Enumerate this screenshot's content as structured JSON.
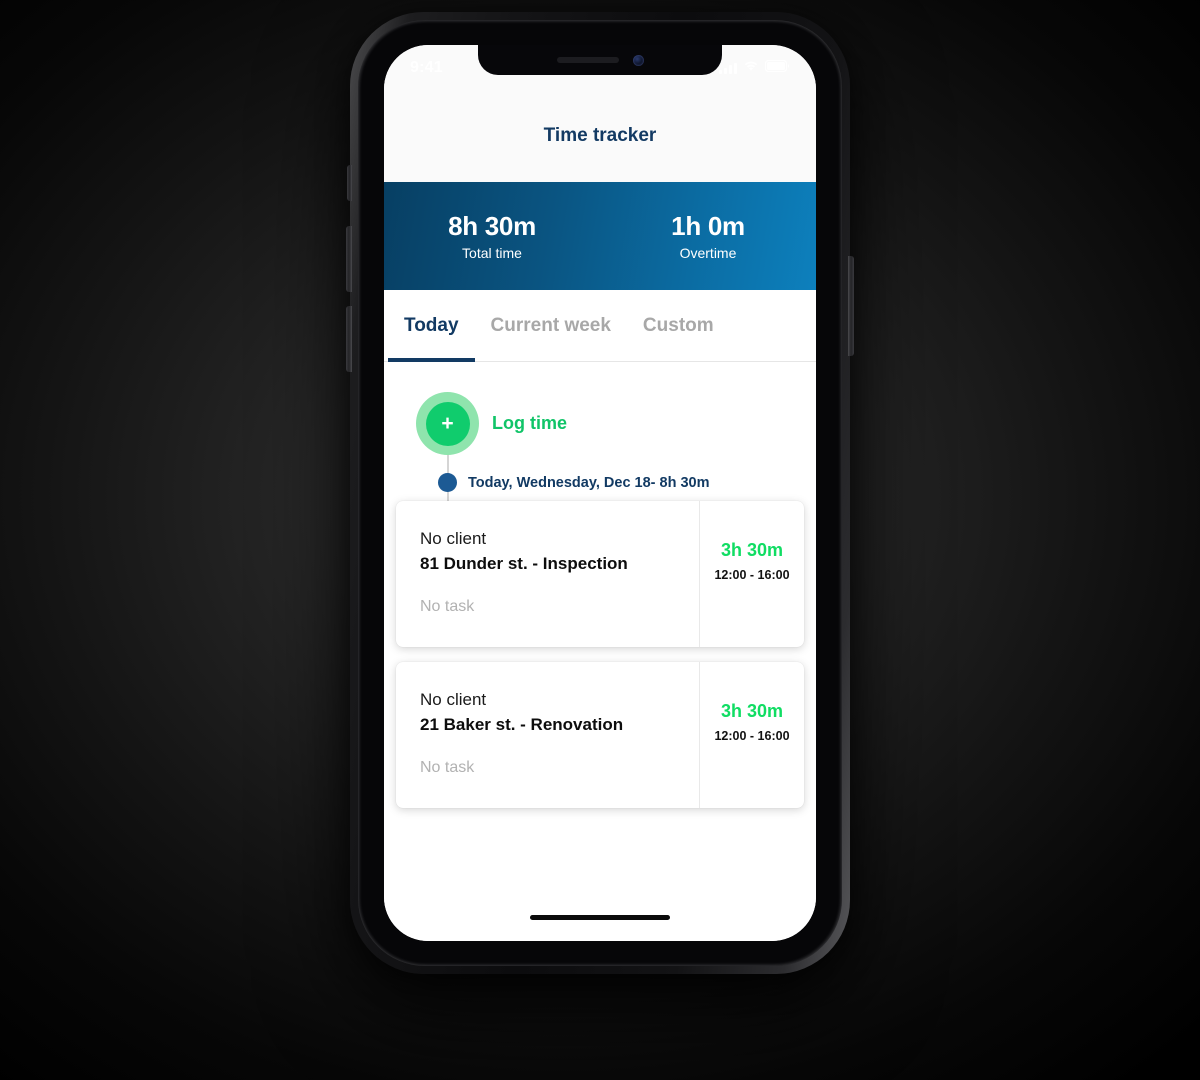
{
  "status_bar": {
    "time": "9:41",
    "icons": [
      "signal-icon",
      "wifi-icon",
      "battery-icon"
    ]
  },
  "header": {
    "title": "Time tracker"
  },
  "summary": {
    "cells": [
      {
        "value": "8h 30m",
        "label": "Total time"
      },
      {
        "value": "1h 0m",
        "label": "Overtime"
      }
    ],
    "gradient_from": "#073f63",
    "gradient_to": "#0d80bd"
  },
  "tabs": [
    {
      "label": "Today",
      "active": true
    },
    {
      "label": "Current week",
      "active": false
    },
    {
      "label": "Custom",
      "active": false
    }
  ],
  "log_time": {
    "icon": "plus-icon",
    "plus_glyph": "+",
    "label": "Log time",
    "accent_color": "#10c468"
  },
  "day_group": {
    "label": "Today, Wednesday, Dec 18- 8h 30m",
    "dot_color": "#1c5a94"
  },
  "entries": [
    {
      "client": "No client",
      "title": "81 Dunder st. - Inspection",
      "task": "No task",
      "duration": "3h 30m",
      "range": "12:00 - 16:00",
      "duration_color": "#10dd63"
    },
    {
      "client": "No client",
      "title": "21 Baker st. - Renovation",
      "task": "No task",
      "duration": "3h 30m",
      "range": "12:00 - 16:00",
      "duration_color": "#10dd63"
    }
  ]
}
